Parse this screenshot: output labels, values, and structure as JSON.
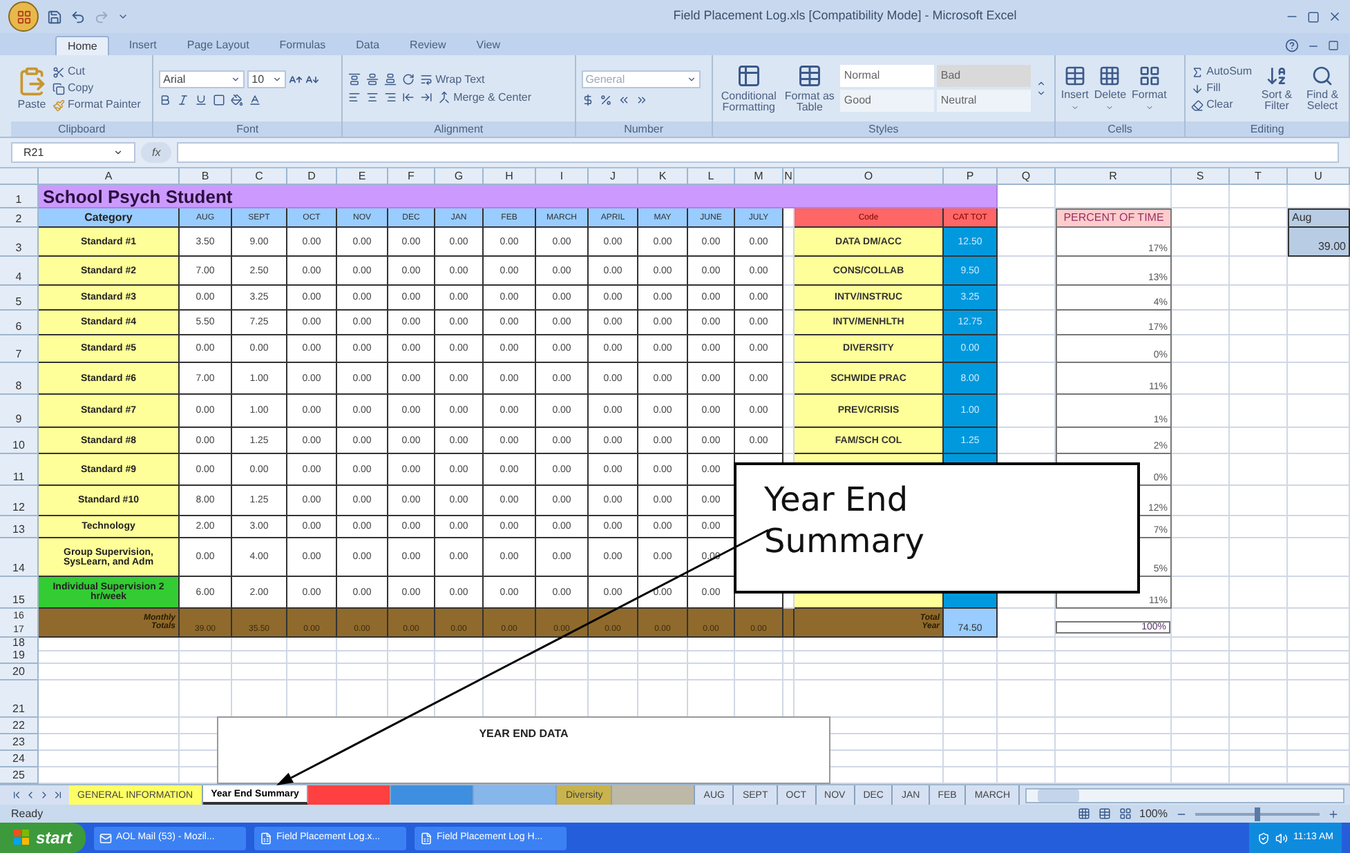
{
  "window": {
    "title": "Field Placement Log.xls  [Compatibility Mode] - Microsoft Excel"
  },
  "ribbon_tabs": [
    {
      "label": "Home",
      "selected": true
    },
    {
      "label": "Insert",
      "selected": false
    },
    {
      "label": "Page Layout",
      "selected": false
    },
    {
      "label": "Formulas",
      "selected": false
    },
    {
      "label": "Data",
      "selected": false
    },
    {
      "label": "Review",
      "selected": false
    },
    {
      "label": "View",
      "selected": false
    }
  ],
  "clipboard": {
    "label": "Clipboard",
    "paste": "Paste",
    "cut": "Cut",
    "copy": "Copy",
    "format_painter": "Format Painter"
  },
  "font": {
    "label": "Font",
    "name": "Arial",
    "size": "10"
  },
  "alignment": {
    "label": "Alignment",
    "wrap": "Wrap Text",
    "merge": "Merge & Center"
  },
  "number": {
    "label": "Number",
    "format": "General"
  },
  "styles": {
    "label": "Styles",
    "conditional": "Conditional Formatting",
    "format_table": "Format as Table",
    "cells": [
      "Normal",
      "Bad",
      "Good",
      "Neutral"
    ]
  },
  "cells": {
    "label": "Cells",
    "buttons": [
      "Insert",
      "Delete",
      "Format"
    ]
  },
  "editing": {
    "label": "Editing",
    "autosum": "AutoSum",
    "fill": "Fill",
    "clear": "Clear",
    "sort": "Sort & Filter",
    "find": "Find & Select"
  },
  "formula_bar": {
    "name_box": "R21",
    "function_label": "fx"
  },
  "column_headers": [
    "A",
    "B",
    "C",
    "D",
    "E",
    "F",
    "G",
    "H",
    "I",
    "J",
    "K",
    "L",
    "M",
    "N",
    "O",
    "P",
    "Q",
    "R",
    "S",
    "T",
    "U"
  ],
  "row_headers": [
    "1",
    "2",
    "3",
    "4",
    "5",
    "6",
    "7",
    "8",
    "9",
    "10",
    "11",
    "12",
    "13",
    "14",
    "15",
    "16",
    "17",
    "18",
    "19",
    "20",
    "21",
    "22",
    "23",
    "24",
    "25"
  ],
  "sheet": {
    "title": "School Psych Student",
    "header": {
      "category": "Category",
      "months": [
        "AUG",
        "SEPT",
        "OCT",
        "NOV",
        "DEC",
        "JAN",
        "FEB",
        "MARCH",
        "APRIL",
        "MAY",
        "JUNE",
        "JULY"
      ],
      "code": "Code",
      "cat_tot": "CAT TOT",
      "percent": "PERCENT OF TIME",
      "extra": "Aug"
    },
    "rows": [
      {
        "category": "Standard #1",
        "color": "#ffff99",
        "values": [
          "3.50",
          "9.00",
          "0.00",
          "0.00",
          "0.00",
          "0.00",
          "0.00",
          "0.00",
          "0.00",
          "0.00",
          "0.00",
          "0.00"
        ],
        "code": "DATA DM/ACC",
        "cat_tot": "12.50",
        "percent": "17%",
        "extra": "39.00"
      },
      {
        "category": "Standard #2",
        "color": "#ffff99",
        "values": [
          "7.00",
          "2.50",
          "0.00",
          "0.00",
          "0.00",
          "0.00",
          "0.00",
          "0.00",
          "0.00",
          "0.00",
          "0.00",
          "0.00"
        ],
        "code": "CONS/COLLAB",
        "cat_tot": "9.50",
        "percent": "13%"
      },
      {
        "category": "Standard #3",
        "color": "#ffff99",
        "values": [
          "0.00",
          "3.25",
          "0.00",
          "0.00",
          "0.00",
          "0.00",
          "0.00",
          "0.00",
          "0.00",
          "0.00",
          "0.00",
          "0.00"
        ],
        "code": "INTV/INSTRUC",
        "cat_tot": "3.25",
        "percent": "4%"
      },
      {
        "category": "Standard #4",
        "color": "#ffff99",
        "values": [
          "5.50",
          "7.25",
          "0.00",
          "0.00",
          "0.00",
          "0.00",
          "0.00",
          "0.00",
          "0.00",
          "0.00",
          "0.00",
          "0.00"
        ],
        "code": "INTV/MENHLTH",
        "cat_tot": "12.75",
        "percent": "17%"
      },
      {
        "category": "Standard #5",
        "color": "#ffff99",
        "values": [
          "0.00",
          "0.00",
          "0.00",
          "0.00",
          "0.00",
          "0.00",
          "0.00",
          "0.00",
          "0.00",
          "0.00",
          "0.00",
          "0.00"
        ],
        "code": "DIVERSITY",
        "cat_tot": "0.00",
        "percent": "0%"
      },
      {
        "category": "Standard #6",
        "color": "#ffff99",
        "values": [
          "7.00",
          "1.00",
          "0.00",
          "0.00",
          "0.00",
          "0.00",
          "0.00",
          "0.00",
          "0.00",
          "0.00",
          "0.00",
          "0.00"
        ],
        "code": "SCHWIDE PRAC",
        "cat_tot": "8.00",
        "percent": "11%"
      },
      {
        "category": "Standard #7",
        "color": "#ffff99",
        "values": [
          "0.00",
          "1.00",
          "0.00",
          "0.00",
          "0.00",
          "0.00",
          "0.00",
          "0.00",
          "0.00",
          "0.00",
          "0.00",
          "0.00"
        ],
        "code": "PREV/CRISIS",
        "cat_tot": "1.00",
        "percent": "1%"
      },
      {
        "category": "Standard #8",
        "color": "#ffff99",
        "values": [
          "0.00",
          "1.25",
          "0.00",
          "0.00",
          "0.00",
          "0.00",
          "0.00",
          "0.00",
          "0.00",
          "0.00",
          "0.00",
          "0.00"
        ],
        "code": "FAM/SCH COL",
        "cat_tot": "1.25",
        "percent": "2%"
      },
      {
        "category": "Standard #9",
        "color": "#ffff99",
        "values": [
          "0.00",
          "0.00",
          "0.00",
          "0.00",
          "0.00",
          "0.00",
          "0.00",
          "0.00",
          "0.00",
          "0.00",
          "0.00"
        ],
        "percent": "0%"
      },
      {
        "category": "Standard #10",
        "color": "#ffff99",
        "values": [
          "8.00",
          "1.25",
          "0.00",
          "0.00",
          "0.00",
          "0.00",
          "0.00",
          "0.00",
          "0.00",
          "0.00",
          "0.00"
        ],
        "percent": "12%"
      },
      {
        "category": "Technology",
        "color": "#ffff99",
        "values": [
          "2.00",
          "3.00",
          "0.00",
          "0.00",
          "0.00",
          "0.00",
          "0.00",
          "0.00",
          "0.00",
          "0.00",
          "0.00"
        ],
        "percent": "7%"
      },
      {
        "category": "Group Supervision, SysLearn, and Adm",
        "color": "#ffff99",
        "values": [
          "0.00",
          "4.00",
          "0.00",
          "0.00",
          "0.00",
          "0.00",
          "0.00",
          "0.00",
          "0.00",
          "0.00",
          "0.00"
        ],
        "percent": "5%"
      },
      {
        "category": "Individual Supervision 2 hr/week",
        "color": "#33cc33",
        "values": [
          "6.00",
          "2.00",
          "0.00",
          "0.00",
          "0.00",
          "0.00",
          "0.00",
          "0.00",
          "0.00",
          "0.00",
          "0.00"
        ],
        "percent": "11%"
      }
    ],
    "totals": {
      "label_lines": [
        "Monthly",
        "Totals"
      ],
      "values": [
        "39.00",
        "35.50",
        "0.00",
        "0.00",
        "0.00",
        "0.00",
        "0.00",
        "0.00",
        "0.00",
        "0.00",
        "0.00",
        "0.00"
      ],
      "year_label_lines": [
        "Total",
        "Year"
      ],
      "year_total": "74.50",
      "percent": "100%"
    }
  },
  "chart": {
    "title": "YEAR END DATA"
  },
  "callout": {
    "text": "Year End Summary"
  },
  "sheet_tabs": [
    {
      "label": "GENERAL INFORMATION",
      "color": "#ffff66",
      "selected": false
    },
    {
      "label": "Year End Summary",
      "selected": true
    },
    {
      "color": "#ff4040",
      "selected": false
    },
    {
      "color": "#3f8fe0",
      "selected": false
    },
    {
      "color": "#86b6ea",
      "selected": false
    },
    {
      "label": "Diversity",
      "color": "#c9b34c",
      "selected": false
    },
    {
      "color": "#bdb9a6",
      "selected": false
    },
    {
      "label": "AUG",
      "selected": false
    },
    {
      "label": "SEPT",
      "selected": false
    },
    {
      "label": "OCT",
      "selected": false
    },
    {
      "label": "NOV",
      "selected": false
    },
    {
      "label": "DEC",
      "selected": false
    },
    {
      "label": "JAN",
      "selected": false
    },
    {
      "label": "FEB",
      "selected": false
    },
    {
      "label": "MARCH",
      "selected": false
    }
  ],
  "status_bar": {
    "status": "Ready",
    "zoom": "100%",
    "zoom_slider": {
      "level": 0.5
    }
  },
  "taskbar": {
    "start": "start",
    "items": [
      "AOL Mail (53) - Mozil...",
      "Field Placement Log.x...",
      "Field Placement Log H..."
    ],
    "clock": "11:13 AM"
  }
}
